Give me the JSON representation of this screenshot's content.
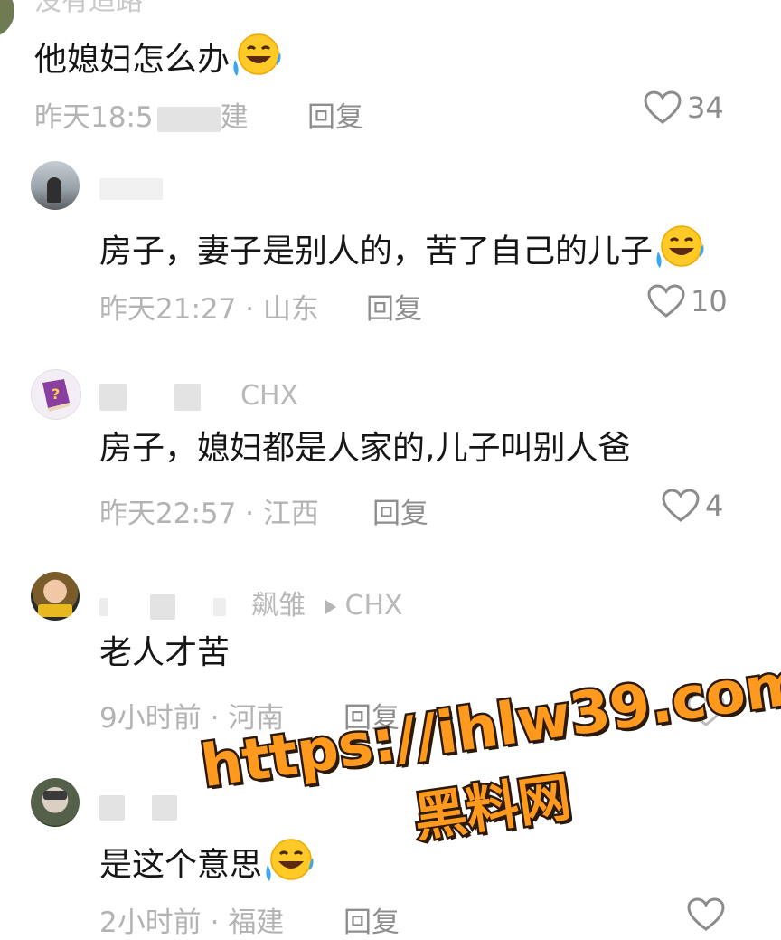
{
  "comments": [
    {
      "id": "c1",
      "name_partial": "没有适路",
      "text": "他媳妇怎么办",
      "has_emoji": true,
      "time": "昨天18:5",
      "location": "建",
      "reply_label": "回复",
      "likes": "34"
    },
    {
      "id": "c2",
      "name_partial": "",
      "text": "房子，妻子是别人的，苦了自己的儿子",
      "has_emoji": true,
      "time": "昨天21:27",
      "location": "山东",
      "reply_label": "回复",
      "likes": "10"
    },
    {
      "id": "c3",
      "name_partial": "CHX",
      "text": "房子，媳妇都是人家的,儿子叫别人爸",
      "has_emoji": false,
      "time": "昨天22:57",
      "location": "江西",
      "reply_label": "回复",
      "likes": "4"
    },
    {
      "id": "c4",
      "name_partial": "飙雏",
      "reply_to": "CHX",
      "text": "老人才苦",
      "has_emoji": false,
      "time": "9小时前",
      "location": "河南",
      "reply_label": "回复",
      "likes": ""
    },
    {
      "id": "c5",
      "name_partial": "",
      "text": "是这个意思",
      "has_emoji": true,
      "time": "2小时前",
      "location": "福建",
      "reply_label": "回复",
      "likes": ""
    }
  ],
  "separator": "·",
  "icons": {
    "like": "heart-outline-icon",
    "emoji": "laughing-crying-emoji",
    "reply_arrow": "triangle-right-icon"
  },
  "watermark": {
    "url": "https://ihlw39.com",
    "label": "黑料网",
    "color": "#ff9a1f"
  }
}
